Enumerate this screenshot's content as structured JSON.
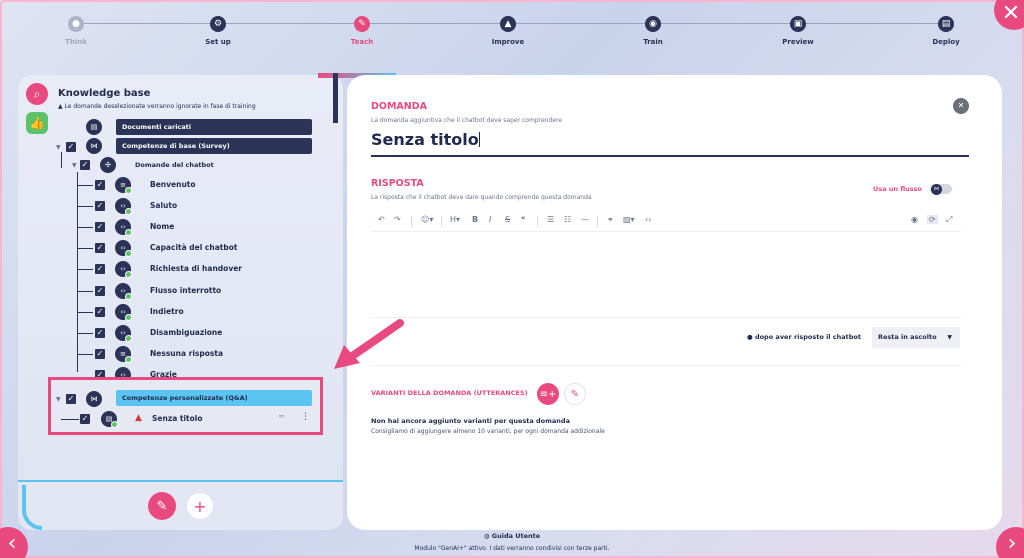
{
  "stepper": {
    "steps": [
      {
        "label": "Think",
        "icon": "lightbulb-icon",
        "state": "done"
      },
      {
        "label": "Set up",
        "icon": "gear-icon",
        "state": "pending"
      },
      {
        "label": "Teach",
        "icon": "pencil-icon",
        "state": "active"
      },
      {
        "label": "Improve",
        "icon": "upload-icon",
        "state": "pending"
      },
      {
        "label": "Train",
        "icon": "brain-icon",
        "state": "pending"
      },
      {
        "label": "Preview",
        "icon": "preview-icon",
        "state": "pending"
      },
      {
        "label": "Deploy",
        "icon": "deploy-icon",
        "state": "pending"
      }
    ]
  },
  "kb": {
    "title": "Knowledge base",
    "warning": "Le domande deselezionate verranno ignorate in fase di training",
    "uploaded_docs": "Documenti caricati",
    "basic_skills": "Competenze di base (Survey)",
    "chatbot_questions": "Domande del chatbot",
    "items": [
      "Benvenuto",
      "Saluto",
      "Nome",
      "Capacità del chatbot",
      "Richiesta di handover",
      "Flusso interrotto",
      "Indietro",
      "Disambiguazione",
      "Nessuna risposta",
      "Grazie"
    ],
    "custom_skills": "Competenze personalizzate (Q&A)",
    "untitled_item": "Senza titolo"
  },
  "question": {
    "heading": "DOMANDA",
    "sub": "La domanda aggiuntiva che il chatbot deve saper comprendere",
    "value": "Senza titolo"
  },
  "answer": {
    "heading": "RISPOSTA",
    "sub": "La risposta che il chatbot deve dare quando comprende questa domanda",
    "use_flow": "Usa un flusso",
    "after_answer": "dopo aver risposto il chatbot",
    "after_answer_value": "Resta in ascolto"
  },
  "toolbar": {
    "heading_btn": "H",
    "bold": "B",
    "italic": "I",
    "strike": "S",
    "quote": "❝"
  },
  "variants": {
    "heading": "VARIANTI DELLA DOMANDA (UTTERANCES)",
    "empty_title": "Non hai ancora aggiunto varianti per questa domanda",
    "empty_sub": "Consigliamo di aggiungere almeno 10 varianti, per ogni domanda addizionale"
  },
  "footer": {
    "guide": "Guida Utente",
    "notice": "Modulo \"GenAI+\" attivo. I dati verranno condivisi con terze parti."
  },
  "colors": {
    "accent": "#e84a7f",
    "navy": "#2b3357",
    "cyan": "#5bc4f0",
    "green": "#5cc36b"
  }
}
